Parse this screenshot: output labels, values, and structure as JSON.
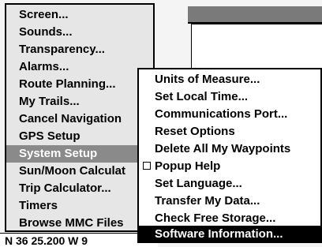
{
  "main_menu": {
    "items": [
      {
        "label": "Screen..."
      },
      {
        "label": "Sounds..."
      },
      {
        "label": "Transparency..."
      },
      {
        "label": "Alarms..."
      },
      {
        "label": "Route Planning..."
      },
      {
        "label": "My Trails..."
      },
      {
        "label": "Cancel Navigation"
      },
      {
        "label": "GPS Setup"
      },
      {
        "label": "System Setup",
        "selected": true
      },
      {
        "label": "Sun/Moon Calculat"
      },
      {
        "label": "Trip Calculator..."
      },
      {
        "label": "Timers"
      },
      {
        "label": "Browse MMC Files"
      }
    ]
  },
  "sub_menu": {
    "items": [
      {
        "label": "Units of Measure..."
      },
      {
        "label": "Set Local Time..."
      },
      {
        "label": "Communications Port..."
      },
      {
        "label": "Reset Options"
      },
      {
        "label": "Delete All My Waypoints"
      },
      {
        "label": "Popup Help",
        "checkbox": true,
        "checked": false
      },
      {
        "label": "Set Language..."
      },
      {
        "label": "Transfer My Data..."
      },
      {
        "label": "Check Free Storage..."
      },
      {
        "label": "Software Information...",
        "selected": true
      }
    ]
  },
  "status": {
    "text": "N   36 25.200   W   9"
  }
}
